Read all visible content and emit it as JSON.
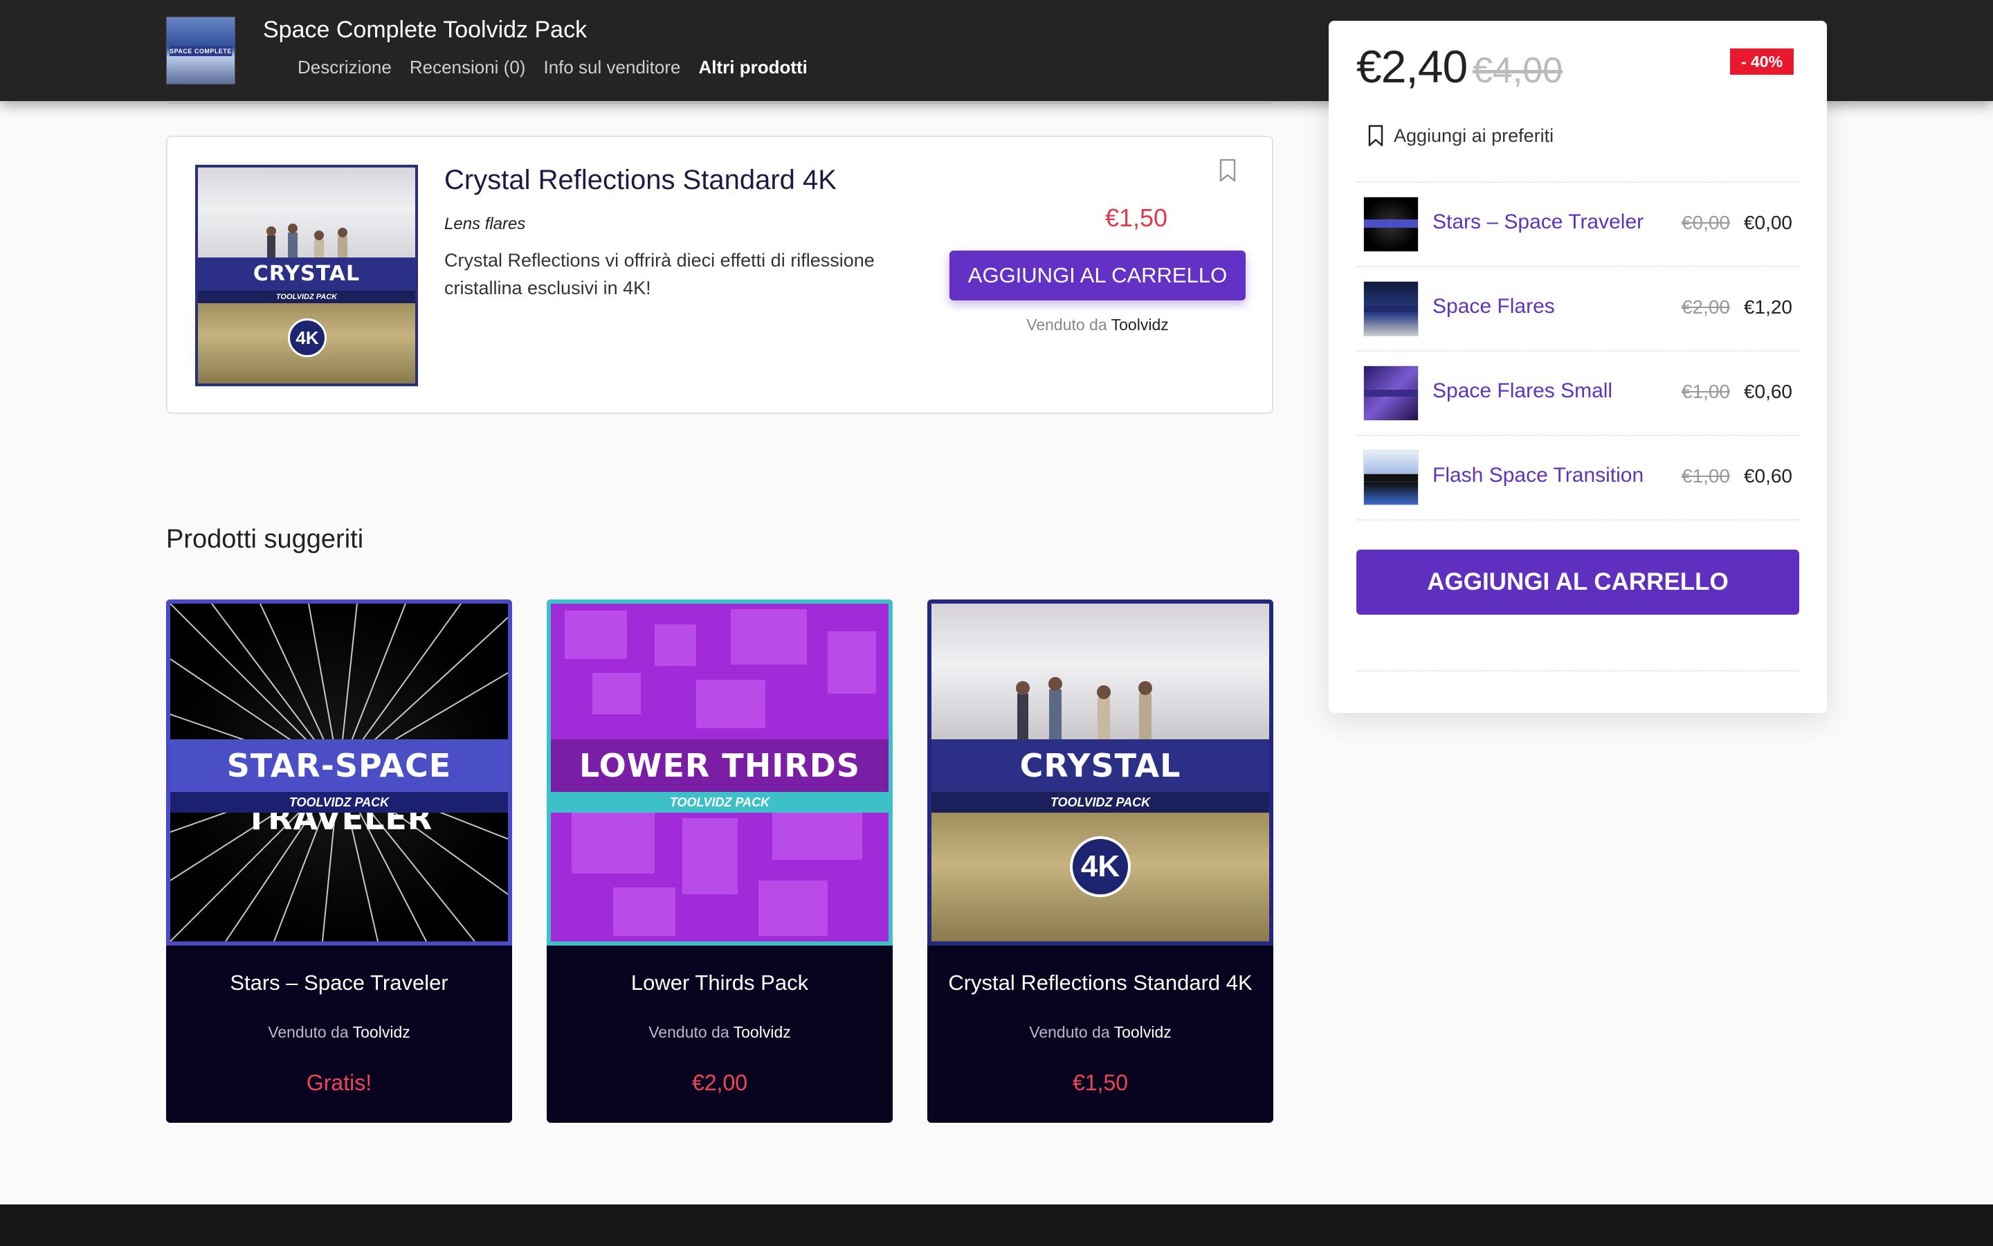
{
  "topbar": {
    "title": "Space Complete Toolvidz Pack",
    "thumb_label": "SPACE COMPLETE",
    "nav": [
      "Descrizione",
      "Recensioni (0)",
      "Info sul venditore",
      "Altri prodotti"
    ],
    "active_nav": "Altri prodotti"
  },
  "product": {
    "title": "Crystal Reflections Standard 4K",
    "category": "Lens flares",
    "description": "Crystal Reflections vi offrirà dieci effetti di riflessione cristallina esclusivi in 4K!",
    "price": "€1,50",
    "button": "AGGIUNGI AL CARRELLO",
    "sold_prefix": "Venduto da",
    "seller": "Toolvidz",
    "image_title": "CRYSTAL REFLECTIONS",
    "image_sub": "TOOLVIDZ PACK",
    "image_badge": "4K"
  },
  "suggested": {
    "title": "Prodotti suggeriti",
    "items": [
      {
        "name": "Stars – Space Traveler",
        "sold_prefix": "Venduto da",
        "seller": "Toolvidz",
        "price": "Gratis!",
        "image_title": "STAR-SPACE TRAVELER",
        "image_sub": "TOOLVIDZ PACK"
      },
      {
        "name": "Lower Thirds Pack",
        "sold_prefix": "Venduto da",
        "seller": "Toolvidz",
        "price": "€2,00",
        "image_title": "LOWER THIRDS",
        "image_sub": "TOOLVIDZ PACK"
      },
      {
        "name": "Crystal Reflections Standard 4K",
        "sold_prefix": "Venduto da",
        "seller": "Toolvidz",
        "price": "€1,50",
        "image_title": "CRYSTAL REFLECTIONS",
        "image_sub": "TOOLVIDZ PACK",
        "image_badge": "4K"
      }
    ]
  },
  "sidebar": {
    "price_now": "€2,40",
    "price_old": "€4,00",
    "discount": "- 40%",
    "favorite": "Aggiungi ai preferiti",
    "related": [
      {
        "name": "Stars – Space Traveler",
        "old": "€0,00",
        "new": "€0,00"
      },
      {
        "name": "Space Flares",
        "old": "€2,00",
        "new": "€1,20"
      },
      {
        "name": "Space Flares Small",
        "old": "€1,00",
        "new": "€0,60"
      },
      {
        "name": "Flash Space Transition",
        "old": "€1,00",
        "new": "€0,60"
      }
    ],
    "button": "AGGIUNGI AL CARRELLO"
  },
  "colors": {
    "accent": "#6331c6",
    "price_red": "#e2384b",
    "topbar_bg": "#242424",
    "tile_bg": "#080420",
    "discount_bg": "#e8192c"
  }
}
